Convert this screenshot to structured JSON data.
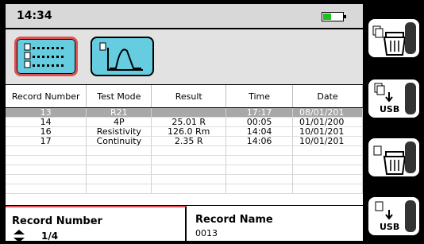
{
  "status": {
    "time": "14:34"
  },
  "table": {
    "columns": [
      "Record Number",
      "Test Mode",
      "Result",
      "Time",
      "Date"
    ],
    "rows": [
      [
        "13",
        "R21",
        "",
        "17:17",
        "08/01/201"
      ],
      [
        "14",
        "4P",
        "25.01 R",
        "00:05",
        "01/01/200"
      ],
      [
        "16",
        "Resistivity",
        "126.0 Rm",
        "14:04",
        "10/01/201"
      ],
      [
        "17",
        "Continuity",
        "2.35 R",
        "14:06",
        "10/01/201"
      ]
    ],
    "selected_row": 0
  },
  "footer": {
    "record_number_label": "Record Number",
    "record_number_value": "1/4",
    "record_name_label": "Record Name",
    "record_name_value": "0013"
  },
  "side_buttons": [
    {
      "icon": "delete-records-icon"
    },
    {
      "icon": "export-all-usb-icon",
      "label": "USB"
    },
    {
      "icon": "delete-record-icon"
    },
    {
      "icon": "export-record-usb-icon",
      "label": "USB"
    }
  ],
  "mode_icons": [
    "table-view-icon",
    "graph-view-icon"
  ],
  "colors": {
    "accent_red": "#e05050",
    "mode_button": "#66cde0",
    "battery": "#1fbf1f",
    "selected_row": "#a8a8a8"
  }
}
